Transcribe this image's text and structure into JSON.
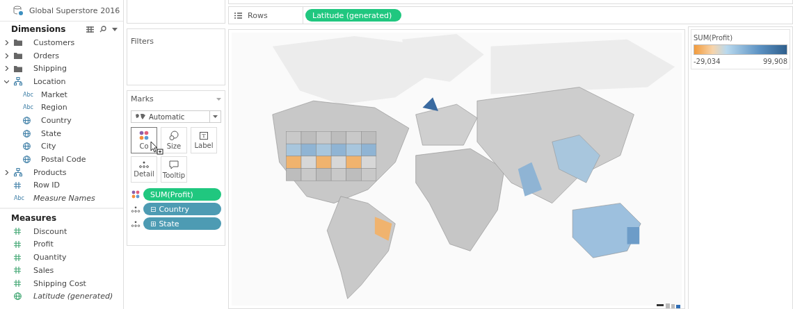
{
  "data_source": {
    "name": "Global Superstore 2016"
  },
  "dimensions": {
    "title": "Dimensions",
    "items": [
      {
        "kind": "folder",
        "label": "Customers",
        "expanded": false
      },
      {
        "kind": "folder",
        "label": "Orders",
        "expanded": false
      },
      {
        "kind": "folder",
        "label": "Shipping",
        "expanded": false
      },
      {
        "kind": "hierarchy",
        "label": "Location",
        "expanded": true,
        "children": [
          {
            "kind": "text",
            "type_label": "Abc",
            "label": "Market"
          },
          {
            "kind": "text",
            "type_label": "Abc",
            "label": "Region"
          },
          {
            "kind": "geo",
            "label": "Country"
          },
          {
            "kind": "geo",
            "label": "State"
          },
          {
            "kind": "geo",
            "label": "City"
          },
          {
            "kind": "geo",
            "label": "Postal Code"
          }
        ]
      },
      {
        "kind": "hierarchy",
        "label": "Products",
        "expanded": false
      },
      {
        "kind": "number",
        "label": "Row ID"
      },
      {
        "kind": "text",
        "type_label": "Abc",
        "label": "Measure Names",
        "italic": true
      }
    ]
  },
  "measures": {
    "title": "Measures",
    "items": [
      {
        "kind": "number",
        "label": "Discount"
      },
      {
        "kind": "number",
        "label": "Profit"
      },
      {
        "kind": "number",
        "label": "Quantity"
      },
      {
        "kind": "number",
        "label": "Sales"
      },
      {
        "kind": "number",
        "label": "Shipping Cost"
      },
      {
        "kind": "geo",
        "label": "Latitude (generated)",
        "italic": true
      }
    ]
  },
  "filters": {
    "title": "Filters"
  },
  "marks": {
    "title": "Marks",
    "mark_type": "Automatic",
    "cards": [
      {
        "kind": "color",
        "label": "Co"
      },
      {
        "kind": "size",
        "label": "Size"
      },
      {
        "kind": "label",
        "label": "Label",
        "icon_text": "T"
      },
      {
        "kind": "detail",
        "label": "Detail"
      },
      {
        "kind": "tooltip",
        "label": "Tooltip"
      }
    ],
    "pills": [
      {
        "kind": "color",
        "label": "SUM(Profit)"
      },
      {
        "kind": "detail",
        "toggle": "⊟",
        "label": "Country"
      },
      {
        "kind": "detail",
        "toggle": "⊞",
        "label": "State"
      }
    ]
  },
  "rows_shelf": {
    "label": "Rows",
    "pills": [
      {
        "kind": "measure",
        "label": "Latitude (generated)"
      }
    ]
  },
  "legend": {
    "title": "SUM(Profit)",
    "min": "-29,034",
    "max": "99,908"
  }
}
